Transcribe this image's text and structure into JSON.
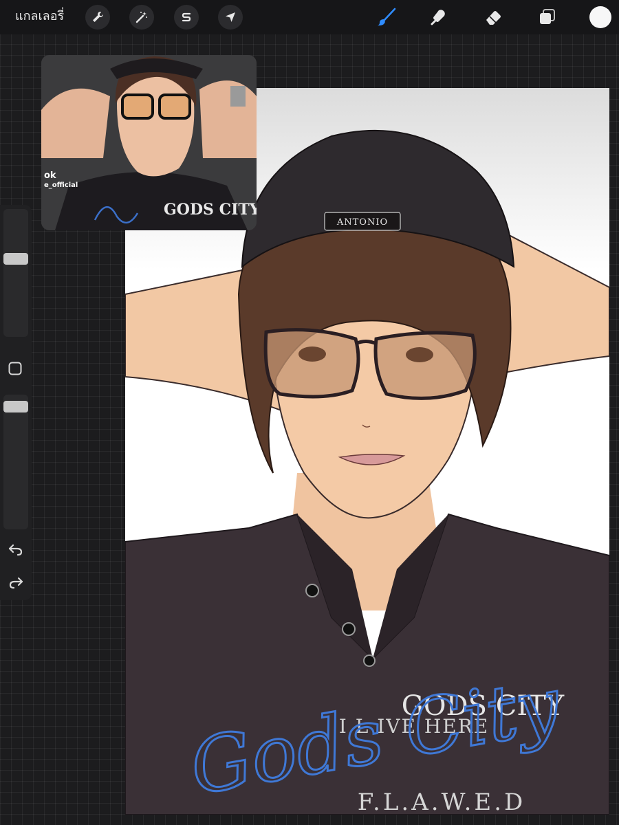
{
  "toolbar": {
    "gallery_label": "แกลเลอรี่",
    "actions_icon": "wrench-icon",
    "adjustments_icon": "magic-wand-icon",
    "selection_icon": "selection-s-icon",
    "transform_icon": "arrow-cursor-icon",
    "brush_icon": "brush-icon",
    "smudge_icon": "smudge-icon",
    "eraser_icon": "eraser-icon",
    "layers_icon": "layers-icon",
    "active_color": "#f7f7f7",
    "brush_accent": "#2f8cff"
  },
  "reference": {
    "caption_line1": "ok",
    "caption_line2": "e_official"
  },
  "sidebar": {
    "brush_size": 0.62,
    "opacity": 0.95,
    "undo_icon": "undo-icon",
    "redo_icon": "redo-icon"
  },
  "artwork": {
    "cap_text": "ANTONIO",
    "shirt_line1": "GODS CITY",
    "shirt_line2": "I L IVE HERE",
    "shirt_line3": "F.L.A.W.E.D",
    "signature": "Gods City"
  }
}
